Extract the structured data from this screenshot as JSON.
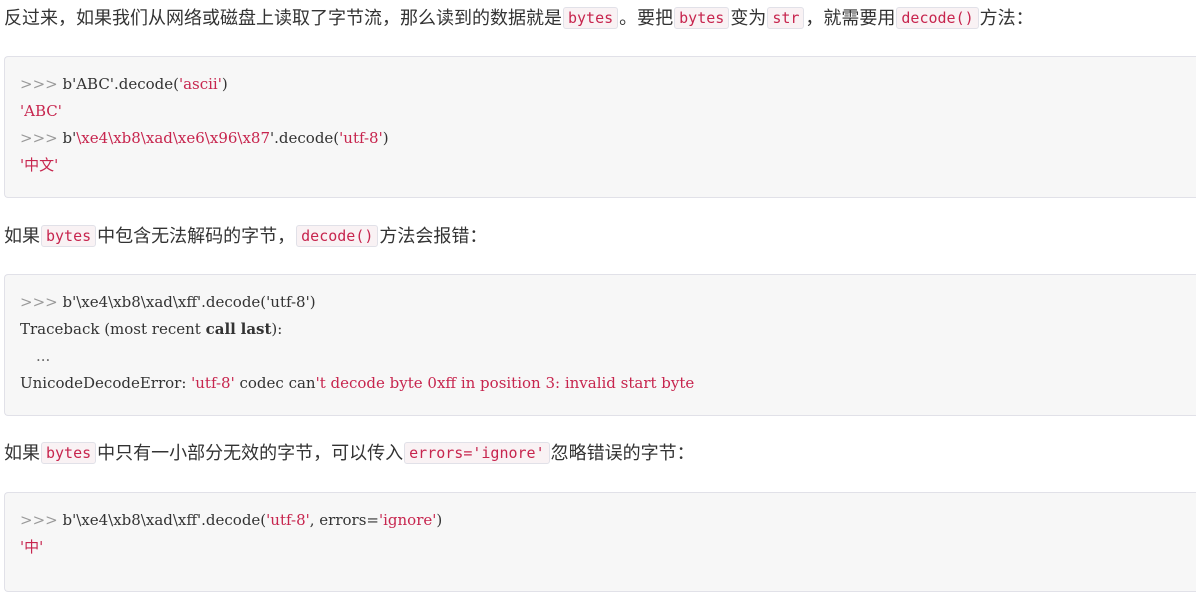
{
  "p1": {
    "t1": "反过来，如果我们从网络或磁盘上读取了字节流，那么读到的数据就是",
    "c1": "bytes",
    "t2": "。要把",
    "c2": "bytes",
    "t3": "变为",
    "c3": "str",
    "t4": "，就需要用",
    "c4": "decode()",
    "t5": "方法："
  },
  "block1": {
    "l1_prompt": ">>> ",
    "l1_code_a": "b'ABC'.decode(",
    "l1_str": "'ascii'",
    "l1_code_b": ")",
    "l2_out": "'ABC'",
    "l3_prompt": ">>> ",
    "l3_code_a": "b'",
    "l3_bytes": "\\xe4\\xb8\\xad\\xe6\\x96\\x87",
    "l3_code_b": "'.decode(",
    "l3_str": "'utf-8'",
    "l3_code_c": ")",
    "l4_out": "'中文'"
  },
  "p2": {
    "t1": "如果",
    "c1": "bytes",
    "t2": "中包含无法解码的字节，",
    "c2": "decode()",
    "t3": "方法会报错："
  },
  "block2": {
    "l1_prompt": ">>> ",
    "l1_code": "b'\\xe4\\xb8\\xad\\xff'.decode('utf-8')",
    "l2_a": "Traceback (most recent ",
    "l2_kw1": "call",
    "l2_b": " ",
    "l2_kw2": "last",
    "l2_c": "):",
    "l3": "...",
    "l4_err": "UnicodeDecodeError: ",
    "l4_str1": "'utf-8'",
    "l4_mid": " codec can",
    "l4_str2": "'t decode byte 0xff in position 3: invalid start byte"
  },
  "p3": {
    "t1": "如果",
    "c1": "bytes",
    "t2": "中只有一小部分无效的字节，可以传入",
    "c2": "errors='ignore'",
    "t3": "忽略错误的字节："
  },
  "block3": {
    "l1_prompt": ">>> ",
    "l1_code_a": "b'\\xe4\\xb8\\xad\\xff'.decode(",
    "l1_str": "'utf-8'",
    "l1_code_b": ", errors=",
    "l1_str2": "'ignore'",
    "l1_code_c": ")",
    "l2_out": "'中'"
  }
}
